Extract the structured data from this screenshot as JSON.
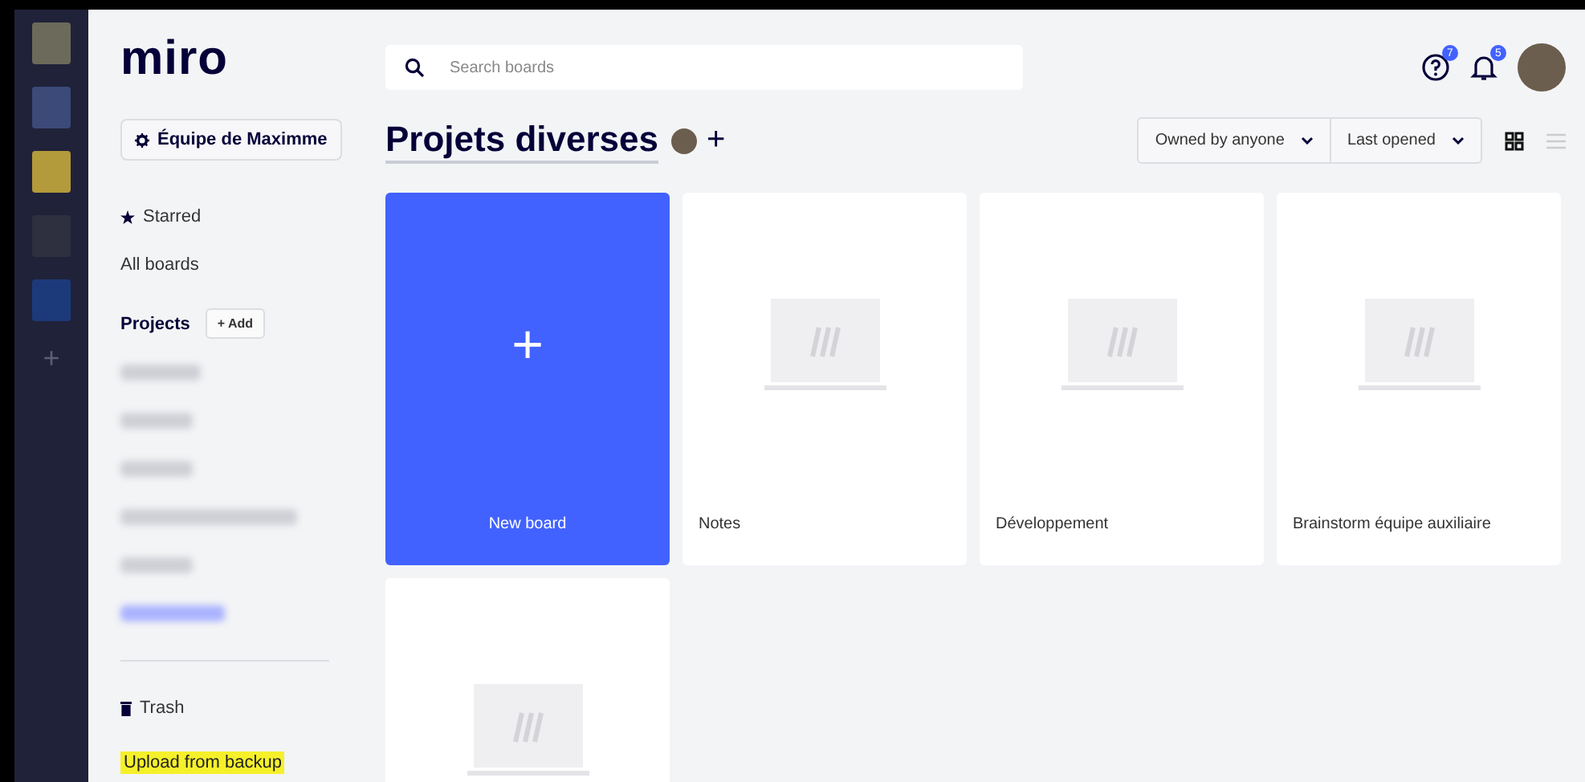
{
  "logo": "miro",
  "search": {
    "placeholder": "Search boards"
  },
  "header": {
    "help_badge": "7",
    "notifications_badge": "5"
  },
  "team_button": "Équipe de Maximme",
  "nav": [
    {
      "label": "Starred"
    },
    {
      "label": "All boards"
    }
  ],
  "projects": {
    "title": "Projects",
    "add_button": "+ Add",
    "items": [
      {
        "selected": false
      },
      {
        "selected": false
      },
      {
        "selected": false
      },
      {
        "selected": false
      },
      {
        "selected": false
      },
      {
        "selected": true
      }
    ]
  },
  "trash": "Trash",
  "upload_link": "Upload from backup",
  "page_title": "Projets diverses",
  "add_member": "+",
  "filters": [
    {
      "label": "Owned by anyone"
    },
    {
      "label": "Last opened"
    }
  ],
  "view": {
    "grid_selected": true
  },
  "boards": [
    {
      "kind": "new",
      "title": "New board",
      "icon": "+"
    },
    {
      "kind": "board",
      "title": "Notes"
    },
    {
      "kind": "board",
      "title": "Développement"
    },
    {
      "kind": "board",
      "title": "Brainstorm équipe auxiliaire"
    },
    {
      "kind": "board"
    }
  ]
}
